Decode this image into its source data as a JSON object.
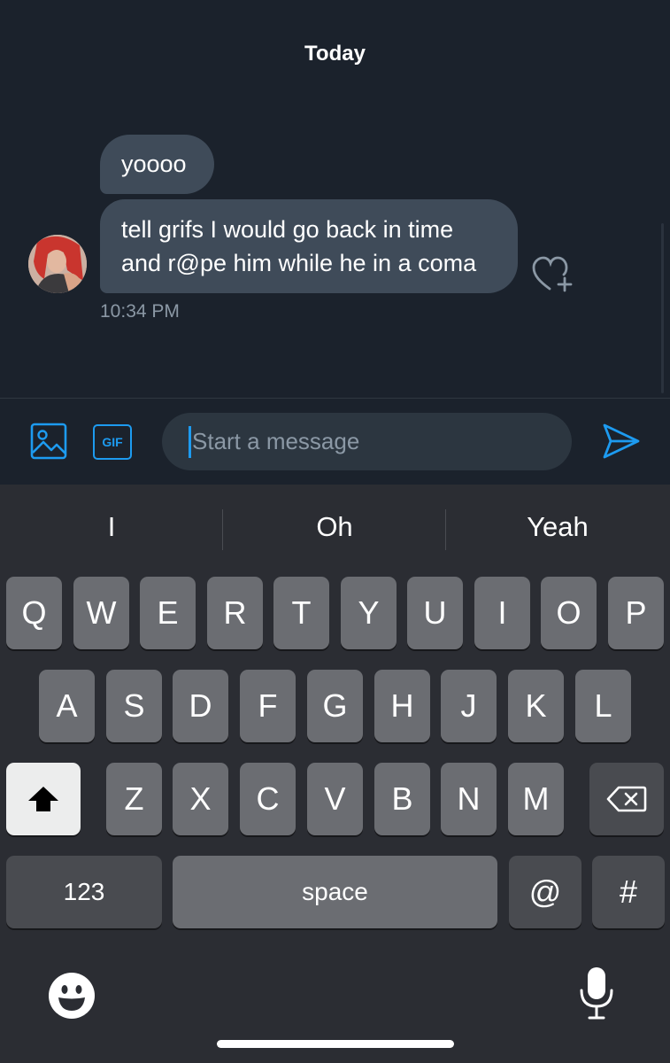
{
  "chat": {
    "date_label": "Today",
    "messages": [
      {
        "text": "yoooo"
      },
      {
        "text": "tell grifs I would go back in time and r@pe him while he in a coma"
      }
    ],
    "timestamp": "10:34 PM",
    "reaction_icon": "heart-plus-icon"
  },
  "composer": {
    "media_icon": "image-icon",
    "gif_label": "GIF",
    "placeholder": "Start a message",
    "send_icon": "send-icon"
  },
  "keyboard": {
    "suggestions": [
      "I",
      "Oh",
      "Yeah"
    ],
    "row1": [
      "Q",
      "W",
      "E",
      "R",
      "T",
      "Y",
      "U",
      "I",
      "O",
      "P"
    ],
    "row2": [
      "A",
      "S",
      "D",
      "F",
      "G",
      "H",
      "J",
      "K",
      "L"
    ],
    "row3": [
      "Z",
      "X",
      "C",
      "V",
      "B",
      "N",
      "M"
    ],
    "numbers_label": "123",
    "space_label": "space",
    "at_label": "@",
    "hash_label": "#",
    "shift_icon": "shift-icon",
    "delete_icon": "backspace-icon",
    "emoji_icon": "emoji-icon",
    "mic_icon": "microphone-icon"
  },
  "colors": {
    "accent": "#1d9bf0",
    "chat_bg": "#1b222c",
    "bubble": "#3f4b59",
    "keyboard_bg": "#2b2d33",
    "key": "#6b6d72"
  }
}
